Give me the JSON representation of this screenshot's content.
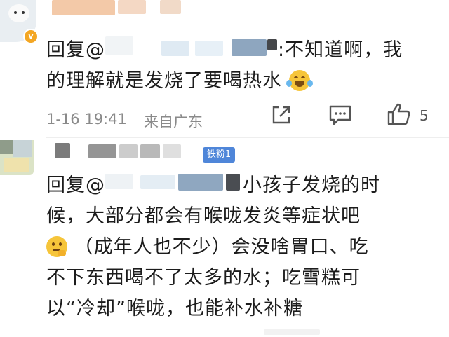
{
  "comment1": {
    "reply_prefix": "回复@",
    "text_after_mention": ":不知道啊，我",
    "text_line2": "的理解就是发烧了要喝热水",
    "emoji_icon": "laugh-cry-emoji",
    "timestamp": "1-16 19:41",
    "location": "来自广东",
    "like_count": "5",
    "accent_color": "#f3a623"
  },
  "comment2": {
    "fan_badge": "铁粉1",
    "reply_prefix": "回复@",
    "line1_tail": "小孩子发烧的时",
    "line2": "候，大部分都会有喉咙发炎等症状吧",
    "line3_after_emoji": "（成年人也不少）会没啥胃口、吃",
    "line3_emoji_icon": "thinking-emoji",
    "line4": "不下东西喝不了太多的水；吃雪糕可",
    "line5": "以“冷却”喉咙，也能补水补糖",
    "badge_color": "#4f86d9"
  }
}
